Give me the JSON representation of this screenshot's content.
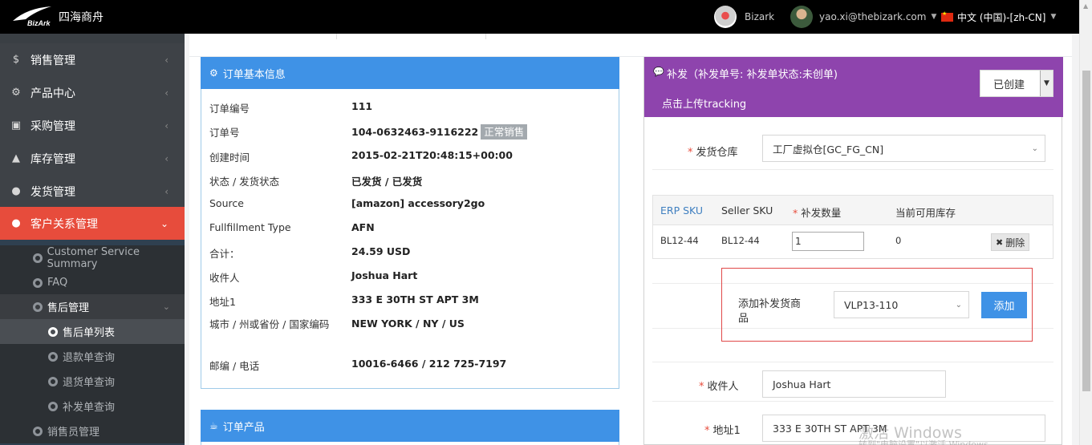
{
  "topbar": {
    "brand": "四海商舟",
    "logo_text": "BizArk",
    "company_name": "Bizark",
    "user_email": "yao.xi@thebizark.com",
    "language": "中文 (中国)-[zh-CN]"
  },
  "sidebar": {
    "items": [
      {
        "icon": "dollar-icon",
        "label": "销售管理"
      },
      {
        "icon": "gears-icon",
        "label": "产品中心"
      },
      {
        "icon": "cube-icon",
        "label": "采购管理"
      },
      {
        "icon": "android-icon",
        "label": "库存管理"
      },
      {
        "icon": "circle-icon",
        "label": "发货管理"
      },
      {
        "icon": "circle-icon",
        "label": "客户关系管理"
      }
    ],
    "crm_sub": [
      {
        "label": "Customer Service Summary"
      },
      {
        "label": "FAQ"
      },
      {
        "label": "售后管理"
      }
    ],
    "aftersale_sub": [
      {
        "label": "售后单列表"
      },
      {
        "label": "退款单查询"
      },
      {
        "label": "退货单查询"
      },
      {
        "label": "补发单查询"
      }
    ],
    "last_item": "销售员管理"
  },
  "order_info": {
    "title": "订单基本信息",
    "rows": [
      {
        "label": "订单编号",
        "value": "111"
      },
      {
        "label": "订单号",
        "value": "104-0632463-9116222",
        "badge": "正常销售"
      },
      {
        "label": "创建时间",
        "value": "2015-02-21T20:48:15+00:00"
      },
      {
        "label": "状态 / 发货状态",
        "value": "已发货 / 已发货"
      },
      {
        "label": "Source",
        "value": "[amazon] accessory2go"
      },
      {
        "label": "Fullfillment Type",
        "value": "AFN"
      },
      {
        "label": "合计：",
        "value": "24.59 USD"
      },
      {
        "label": "收件人",
        "value": "Joshua Hart"
      },
      {
        "label": "地址1",
        "value": "333 E 30TH ST APT 3M"
      },
      {
        "label": "城市 / 州或省份 / 国家编码",
        "value": "NEW YORK / NY / US"
      },
      {
        "label": "邮编 / 电话",
        "value": "10016-6466 / 212 725-7197"
      }
    ]
  },
  "order_products": {
    "title": "订单产品"
  },
  "reship": {
    "title": "补发（补发单号:   补发单状态:未创单)",
    "status_select": "已创建",
    "upload_link": "点击上传tracking",
    "warehouse_label": "发货仓库",
    "warehouse_value": "工厂虚拟仓[GC_FG_CN]",
    "table_headers": [
      "ERP SKU",
      "Seller SKU",
      "补发数量",
      "当前可用库存"
    ],
    "table_rows": [
      {
        "erp_sku": "BL12-44",
        "seller_sku": "BL12-44",
        "qty": "1",
        "stock": "0",
        "action": "删除"
      }
    ],
    "add_label": "添加补发货商品",
    "add_select": "VLP13-110",
    "add_button": "添加",
    "recipient_label": "收件人",
    "recipient_value": "Joshua Hart",
    "address_label": "地址1",
    "address_value": "333 E 30TH ST APT 3M"
  },
  "watermark": {
    "line1": "激活 Windows",
    "line2": "转到\"电脑设置\"以激活 Windows。"
  },
  "colors": {
    "accent_blue": "#3f92e6",
    "accent_purple": "#8e44ad",
    "active_red": "#e74c3c"
  }
}
